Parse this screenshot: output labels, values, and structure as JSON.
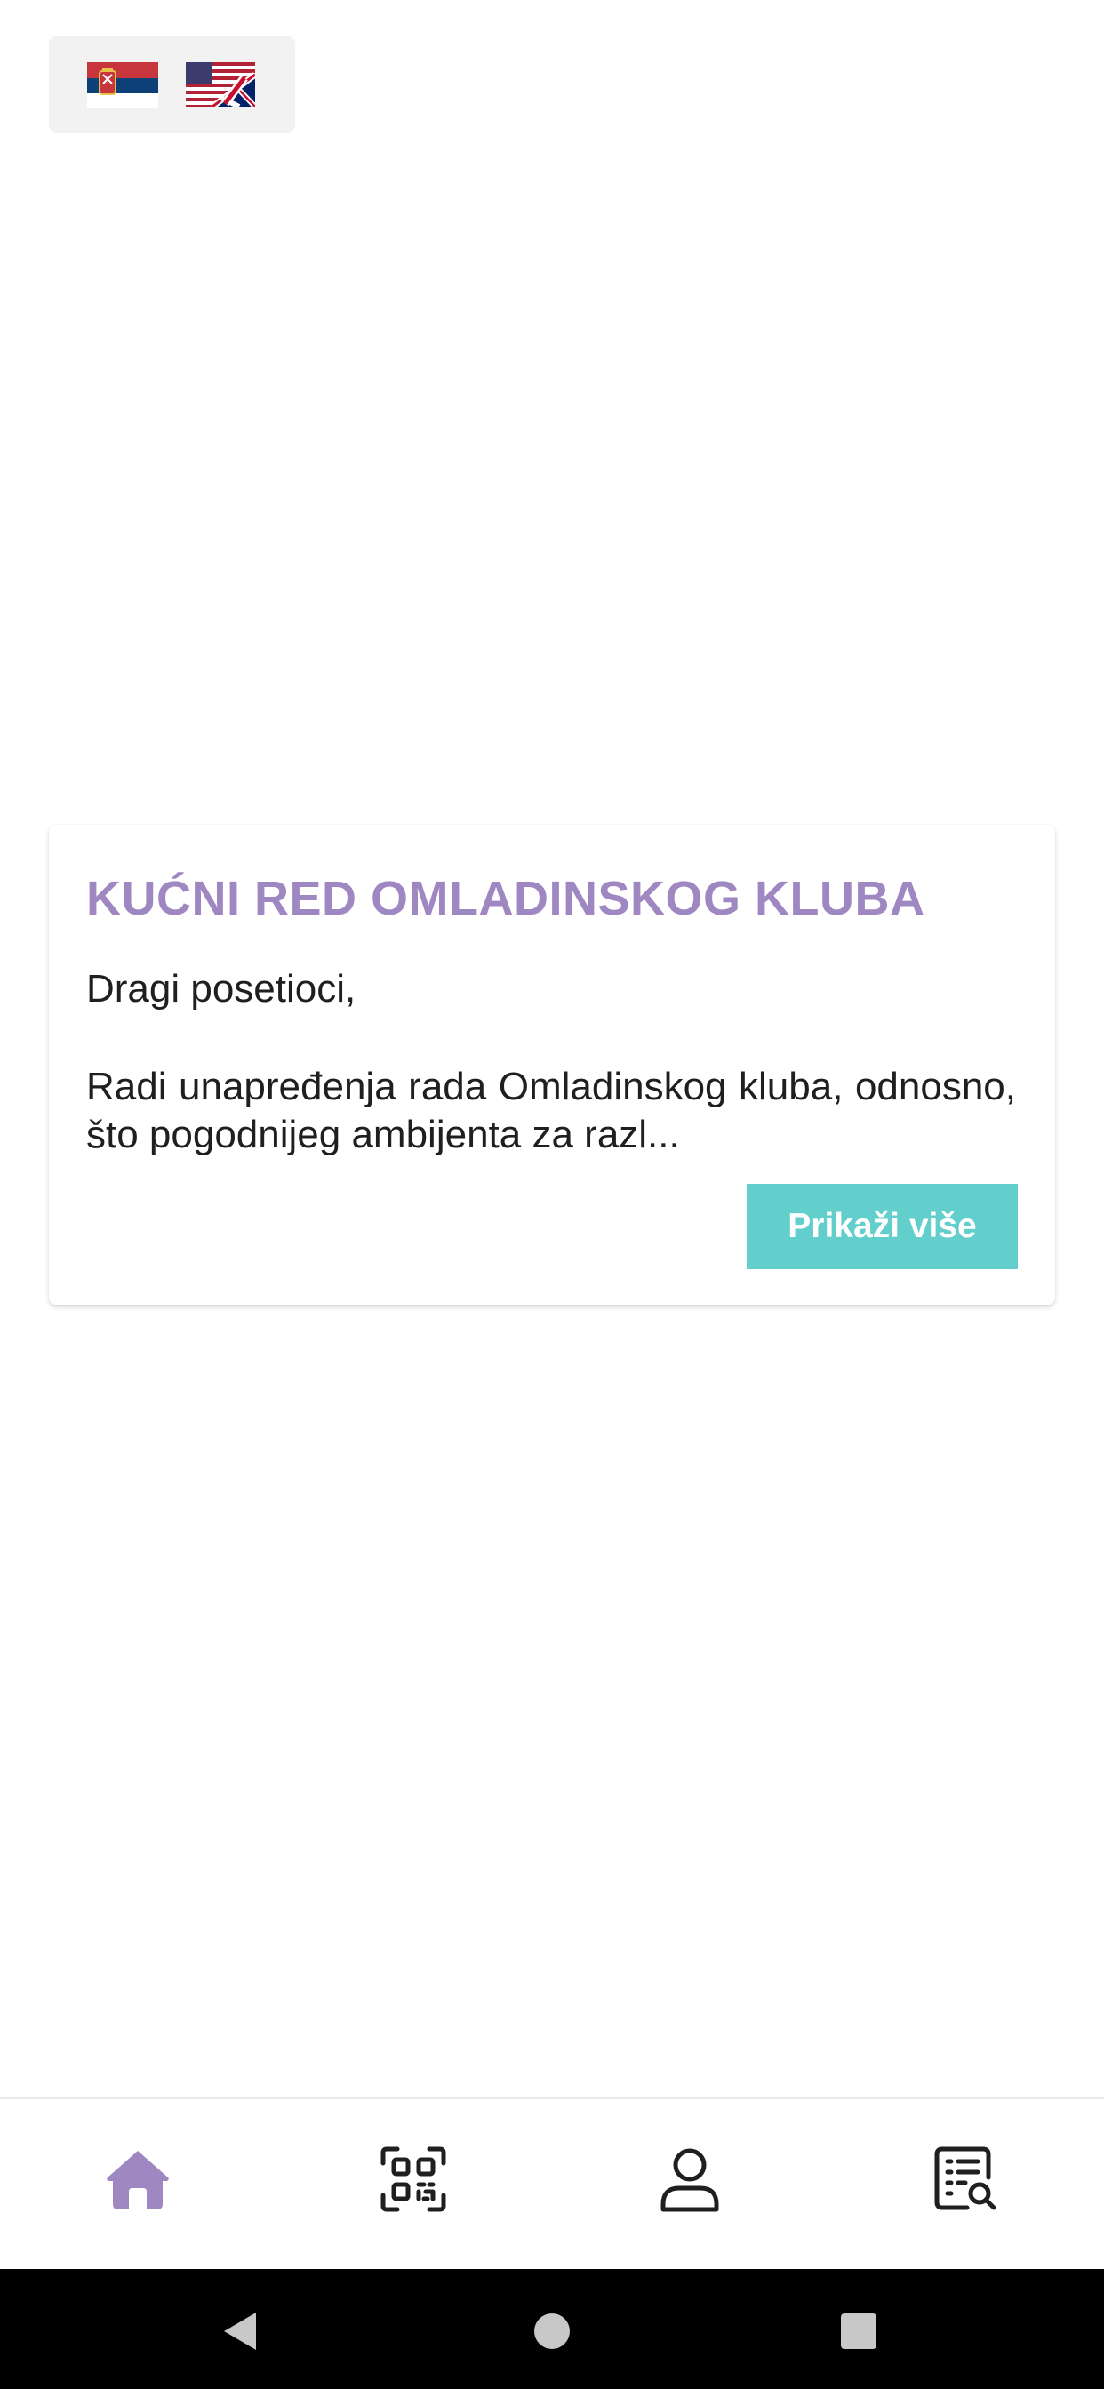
{
  "language_switcher": {
    "languages": [
      {
        "icon": "serbian-flag-icon"
      },
      {
        "icon": "english-flag-icon"
      }
    ]
  },
  "announcement": {
    "title": "KUĆNI RED OMLADINSKOG KLUBA",
    "greeting": "Dragi posetioci,",
    "excerpt": "Radi unapređenja rada Omladinskog kluba, odnosno, što pogodnijeg ambijenta za razl...",
    "more_label": "Prikaži više"
  },
  "bottom_nav": {
    "items": [
      {
        "icon": "home-icon",
        "active": true
      },
      {
        "icon": "qr-code-icon",
        "active": false
      },
      {
        "icon": "profile-icon",
        "active": false
      },
      {
        "icon": "search-list-icon",
        "active": false
      }
    ],
    "active_color": "#9f87c2",
    "inactive_color": "#1f1f1f"
  },
  "colors": {
    "accent_title": "#9f87c2",
    "button": "#62cfcc"
  }
}
